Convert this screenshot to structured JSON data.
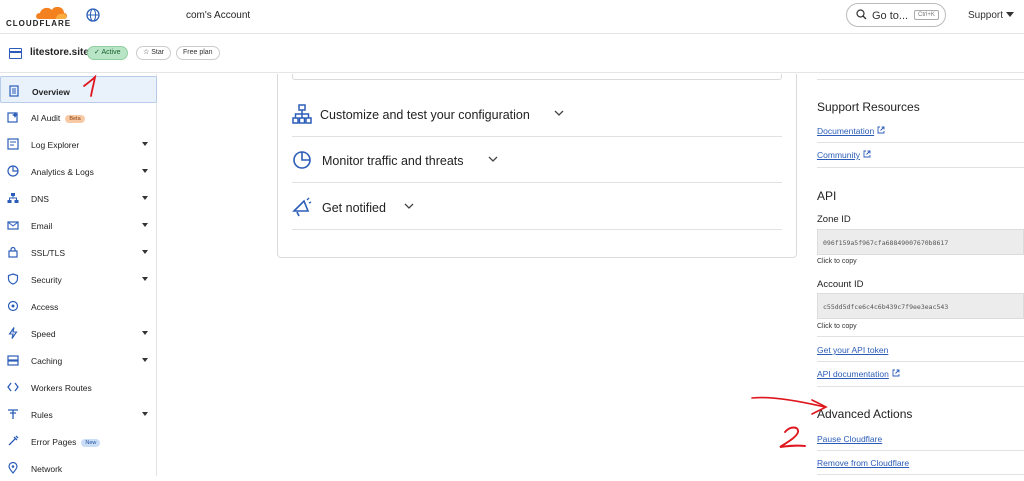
{
  "topbar": {
    "logo_text": "CLOUDFLARE",
    "account_name": "com's Account",
    "search_label": "Go to...",
    "search_shortcut": "Ctrl+K",
    "support_label": "Support"
  },
  "zone": {
    "name": "litestore.site",
    "status": "Active",
    "star_label": "Star",
    "plan": "Free plan"
  },
  "sidebar": {
    "items": [
      {
        "label": "Overview",
        "icon": "document-icon",
        "selected": true
      },
      {
        "label": "AI Audit",
        "icon": "ai-audit-icon",
        "badge": "Beta"
      },
      {
        "label": "Log Explorer",
        "icon": "log-explorer-icon",
        "expandable": true
      },
      {
        "label": "Analytics & Logs",
        "icon": "pie-chart-icon",
        "expandable": true
      },
      {
        "label": "DNS",
        "icon": "dns-icon",
        "expandable": true
      },
      {
        "label": "Email",
        "icon": "email-icon",
        "expandable": true
      },
      {
        "label": "SSL/TLS",
        "icon": "lock-icon",
        "expandable": true
      },
      {
        "label": "Security",
        "icon": "shield-icon",
        "expandable": true
      },
      {
        "label": "Access",
        "icon": "access-icon"
      },
      {
        "label": "Speed",
        "icon": "lightning-icon",
        "expandable": true
      },
      {
        "label": "Caching",
        "icon": "caching-icon",
        "expandable": true
      },
      {
        "label": "Workers Routes",
        "icon": "workers-icon"
      },
      {
        "label": "Rules",
        "icon": "rules-icon",
        "expandable": true
      },
      {
        "label": "Error Pages",
        "icon": "error-pages-icon",
        "badge": "New"
      },
      {
        "label": "Network",
        "icon": "location-pin-icon"
      }
    ]
  },
  "main": {
    "sections": [
      {
        "title": "Customize and test your configuration",
        "icon": "sitemap-icon"
      },
      {
        "title": "Monitor traffic and threats",
        "icon": "clock-chart-icon"
      },
      {
        "title": "Get notified",
        "icon": "megaphone-icon"
      }
    ]
  },
  "right": {
    "support_title": "Support Resources",
    "documentation": "Documentation",
    "community": "Community",
    "api_title": "API",
    "zone_id_label": "Zone ID",
    "zone_id": "096f159a5f967cfa68849007670b8617",
    "click_to_copy": "Click to copy",
    "account_id_label": "Account ID",
    "account_id": "c55dd5dfce6c4c6b439c7f9ee3eac543",
    "api_token": "Get your API token",
    "api_docs": "API documentation",
    "advanced_title": "Advanced Actions",
    "pause": "Pause Cloudflare",
    "remove": "Remove from Cloudflare"
  },
  "annotations": [
    "1",
    "2"
  ],
  "colors": {
    "brand_orange": "#f48120",
    "link_blue": "#2b5db8",
    "annotation_red": "#e0161e",
    "active_green": "#b9e5c7"
  }
}
